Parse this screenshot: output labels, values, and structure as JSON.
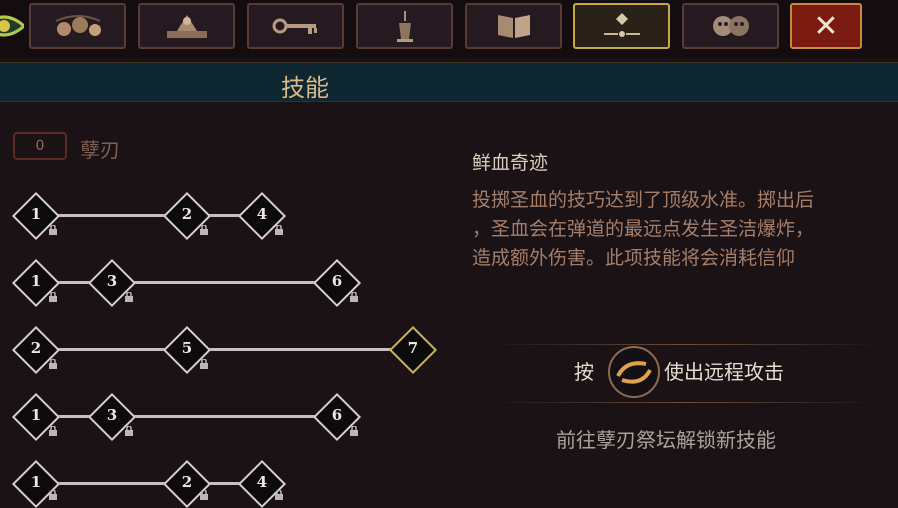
{
  "tabs": [
    {
      "icon": "trinkets-icon"
    },
    {
      "icon": "altar-icon"
    },
    {
      "icon": "keys-icon"
    },
    {
      "icon": "lantern-icon"
    },
    {
      "icon": "book-icon"
    },
    {
      "icon": "skill-icon",
      "active": true
    },
    {
      "icon": "masks-icon"
    }
  ],
  "close_label": "✕",
  "header": {
    "title": "技能"
  },
  "skill_points": "0",
  "weapon_name": "孽刃",
  "skill_rows": [
    {
      "nodes": [
        "1",
        "2",
        "4"
      ]
    },
    {
      "nodes": [
        "1",
        "3",
        "6"
      ]
    },
    {
      "nodes": [
        "2",
        "5",
        "7"
      ]
    },
    {
      "nodes": [
        "1",
        "3",
        "6"
      ]
    },
    {
      "nodes": [
        "1",
        "2",
        "4"
      ]
    }
  ],
  "skill": {
    "title": "鲜血奇迹",
    "description": "投掷圣血的技巧达到了顶级水准。掷出后\n，圣血会在弹道的最远点发生圣洁爆炸，\n造成额外伤害。此项技能将会消耗信仰"
  },
  "control_hint": {
    "prefix": "按",
    "suffix": "使出远程攻击",
    "button_icon": "ranged-attack-button-icon"
  },
  "unlock_hint": "前往孽刃祭坛解锁新技能",
  "colors": {
    "background": "#1b1216",
    "header": "#0f2730",
    "gold": "#cdb45a",
    "close": "#7a1a10"
  }
}
